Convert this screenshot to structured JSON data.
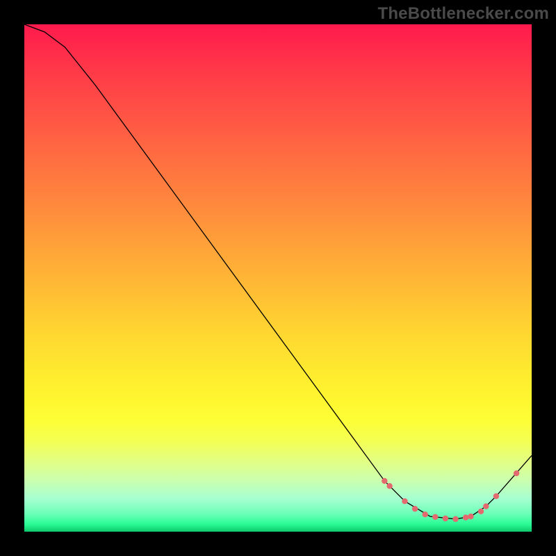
{
  "watermark": {
    "text": "TheBottlenecker.com"
  },
  "chart_data": {
    "type": "line",
    "title": "",
    "xlabel": "",
    "ylabel": "",
    "xlim": [
      0,
      100
    ],
    "ylim": [
      0,
      100
    ],
    "series": [
      {
        "name": "curve",
        "x": [
          0,
          4,
          8,
          10,
          14,
          71,
          72,
          75,
          80,
          85,
          88,
          91,
          93,
          100
        ],
        "y": [
          100,
          98.5,
          95.5,
          93,
          88,
          10,
          9,
          6,
          3,
          2.5,
          3,
          5,
          7,
          15
        ]
      }
    ],
    "markers": {
      "name": "highlight-dots",
      "color": "#e36a6f",
      "x": [
        71,
        72,
        75,
        77,
        79,
        81,
        83,
        85,
        87,
        88,
        90,
        91,
        93,
        97
      ],
      "y": [
        10,
        9,
        6,
        4.5,
        3.4,
        2.9,
        2.6,
        2.5,
        2.8,
        3,
        4,
        5,
        7,
        11.5
      ]
    },
    "gradient_stops": [
      {
        "offset": 0.0,
        "color": "#ff1a4d"
      },
      {
        "offset": 0.05,
        "color": "#ff2b4a"
      },
      {
        "offset": 0.12,
        "color": "#ff4247"
      },
      {
        "offset": 0.2,
        "color": "#ff5a44"
      },
      {
        "offset": 0.28,
        "color": "#ff7240"
      },
      {
        "offset": 0.36,
        "color": "#ff8a3d"
      },
      {
        "offset": 0.44,
        "color": "#ffa339"
      },
      {
        "offset": 0.52,
        "color": "#ffbb35"
      },
      {
        "offset": 0.6,
        "color": "#ffd431"
      },
      {
        "offset": 0.68,
        "color": "#fee92f"
      },
      {
        "offset": 0.74,
        "color": "#fff62f"
      },
      {
        "offset": 0.78,
        "color": "#fdfe36"
      },
      {
        "offset": 0.82,
        "color": "#f4ff52"
      },
      {
        "offset": 0.86,
        "color": "#e3ff82"
      },
      {
        "offset": 0.9,
        "color": "#caffb0"
      },
      {
        "offset": 0.935,
        "color": "#a6ffd1"
      },
      {
        "offset": 0.965,
        "color": "#6bffb7"
      },
      {
        "offset": 0.985,
        "color": "#2bfc95"
      },
      {
        "offset": 1.0,
        "color": "#0cc96b"
      }
    ]
  }
}
